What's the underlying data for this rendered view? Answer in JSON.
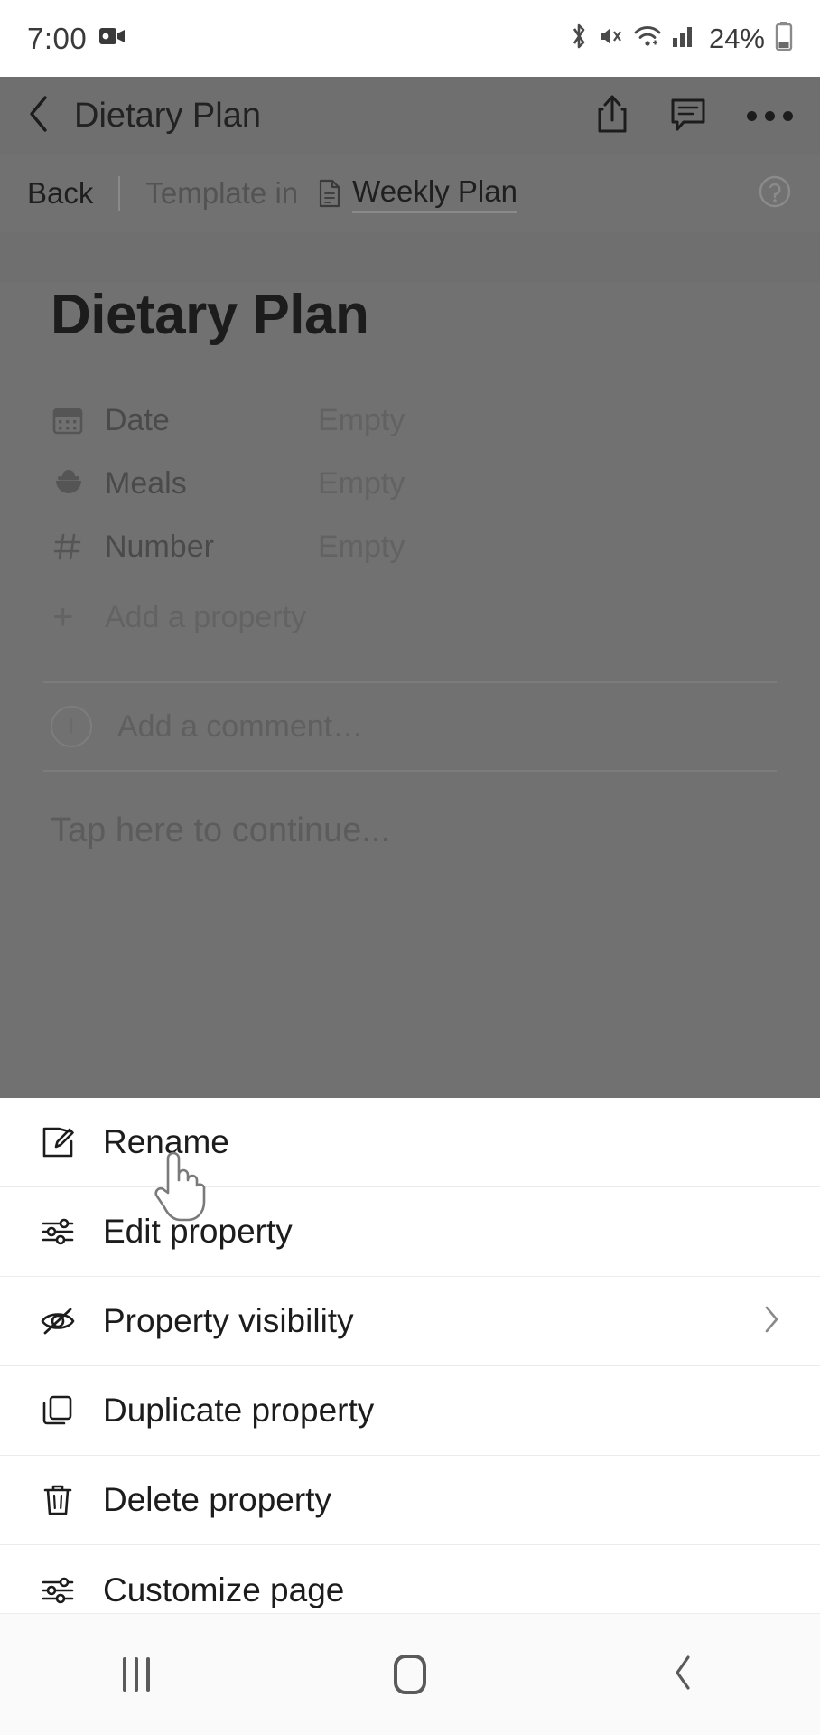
{
  "statusbar": {
    "time": "7:00",
    "battery_text": "24%",
    "icons": [
      "video-record-icon",
      "bluetooth-icon",
      "mute-icon",
      "wifi-icon",
      "cellular-signal-icon",
      "battery-icon"
    ]
  },
  "app_header": {
    "back_label": "back-chevron",
    "title": "Dietary Plan",
    "actions": [
      "share-icon",
      "comment-icon",
      "overflow-menu-icon"
    ]
  },
  "breadcrumb": {
    "back": "Back",
    "template_in": "Template in",
    "page": "Weekly Plan",
    "help": "?"
  },
  "page": {
    "title": "Dietary Plan",
    "properties": [
      {
        "icon": "calendar-icon",
        "name": "Date",
        "value": "Empty"
      },
      {
        "icon": "meal-bowl-icon",
        "name": "Meals",
        "value": "Empty"
      },
      {
        "icon": "hash-icon",
        "name": "Number",
        "value": "Empty"
      }
    ],
    "add_property": "Add a property",
    "comment_placeholder": "Add a comment…",
    "avatar_initial": "I",
    "continue_text": "Tap here to continue..."
  },
  "sheet": {
    "items": [
      {
        "icon": "rename-pencil-icon",
        "label": "Rename",
        "chevron": false
      },
      {
        "icon": "edit-sliders-icon",
        "label": "Edit property",
        "chevron": false
      },
      {
        "icon": "eye-off-icon",
        "label": "Property visibility",
        "chevron": true
      },
      {
        "icon": "duplicate-copy-icon",
        "label": "Duplicate property",
        "chevron": false
      },
      {
        "icon": "trash-icon",
        "label": "Delete property",
        "chevron": false
      },
      {
        "icon": "customize-sliders-icon",
        "label": "Customize page",
        "chevron": false
      }
    ]
  },
  "navbar": {
    "recents": "recents-icon",
    "home": "home-icon",
    "back": "back-icon"
  },
  "colors": {
    "scrim": "#6f6f6f",
    "sheet_bg": "#ffffff",
    "text_primary": "#1c1c1c",
    "navbar_bg": "#fafafa"
  }
}
